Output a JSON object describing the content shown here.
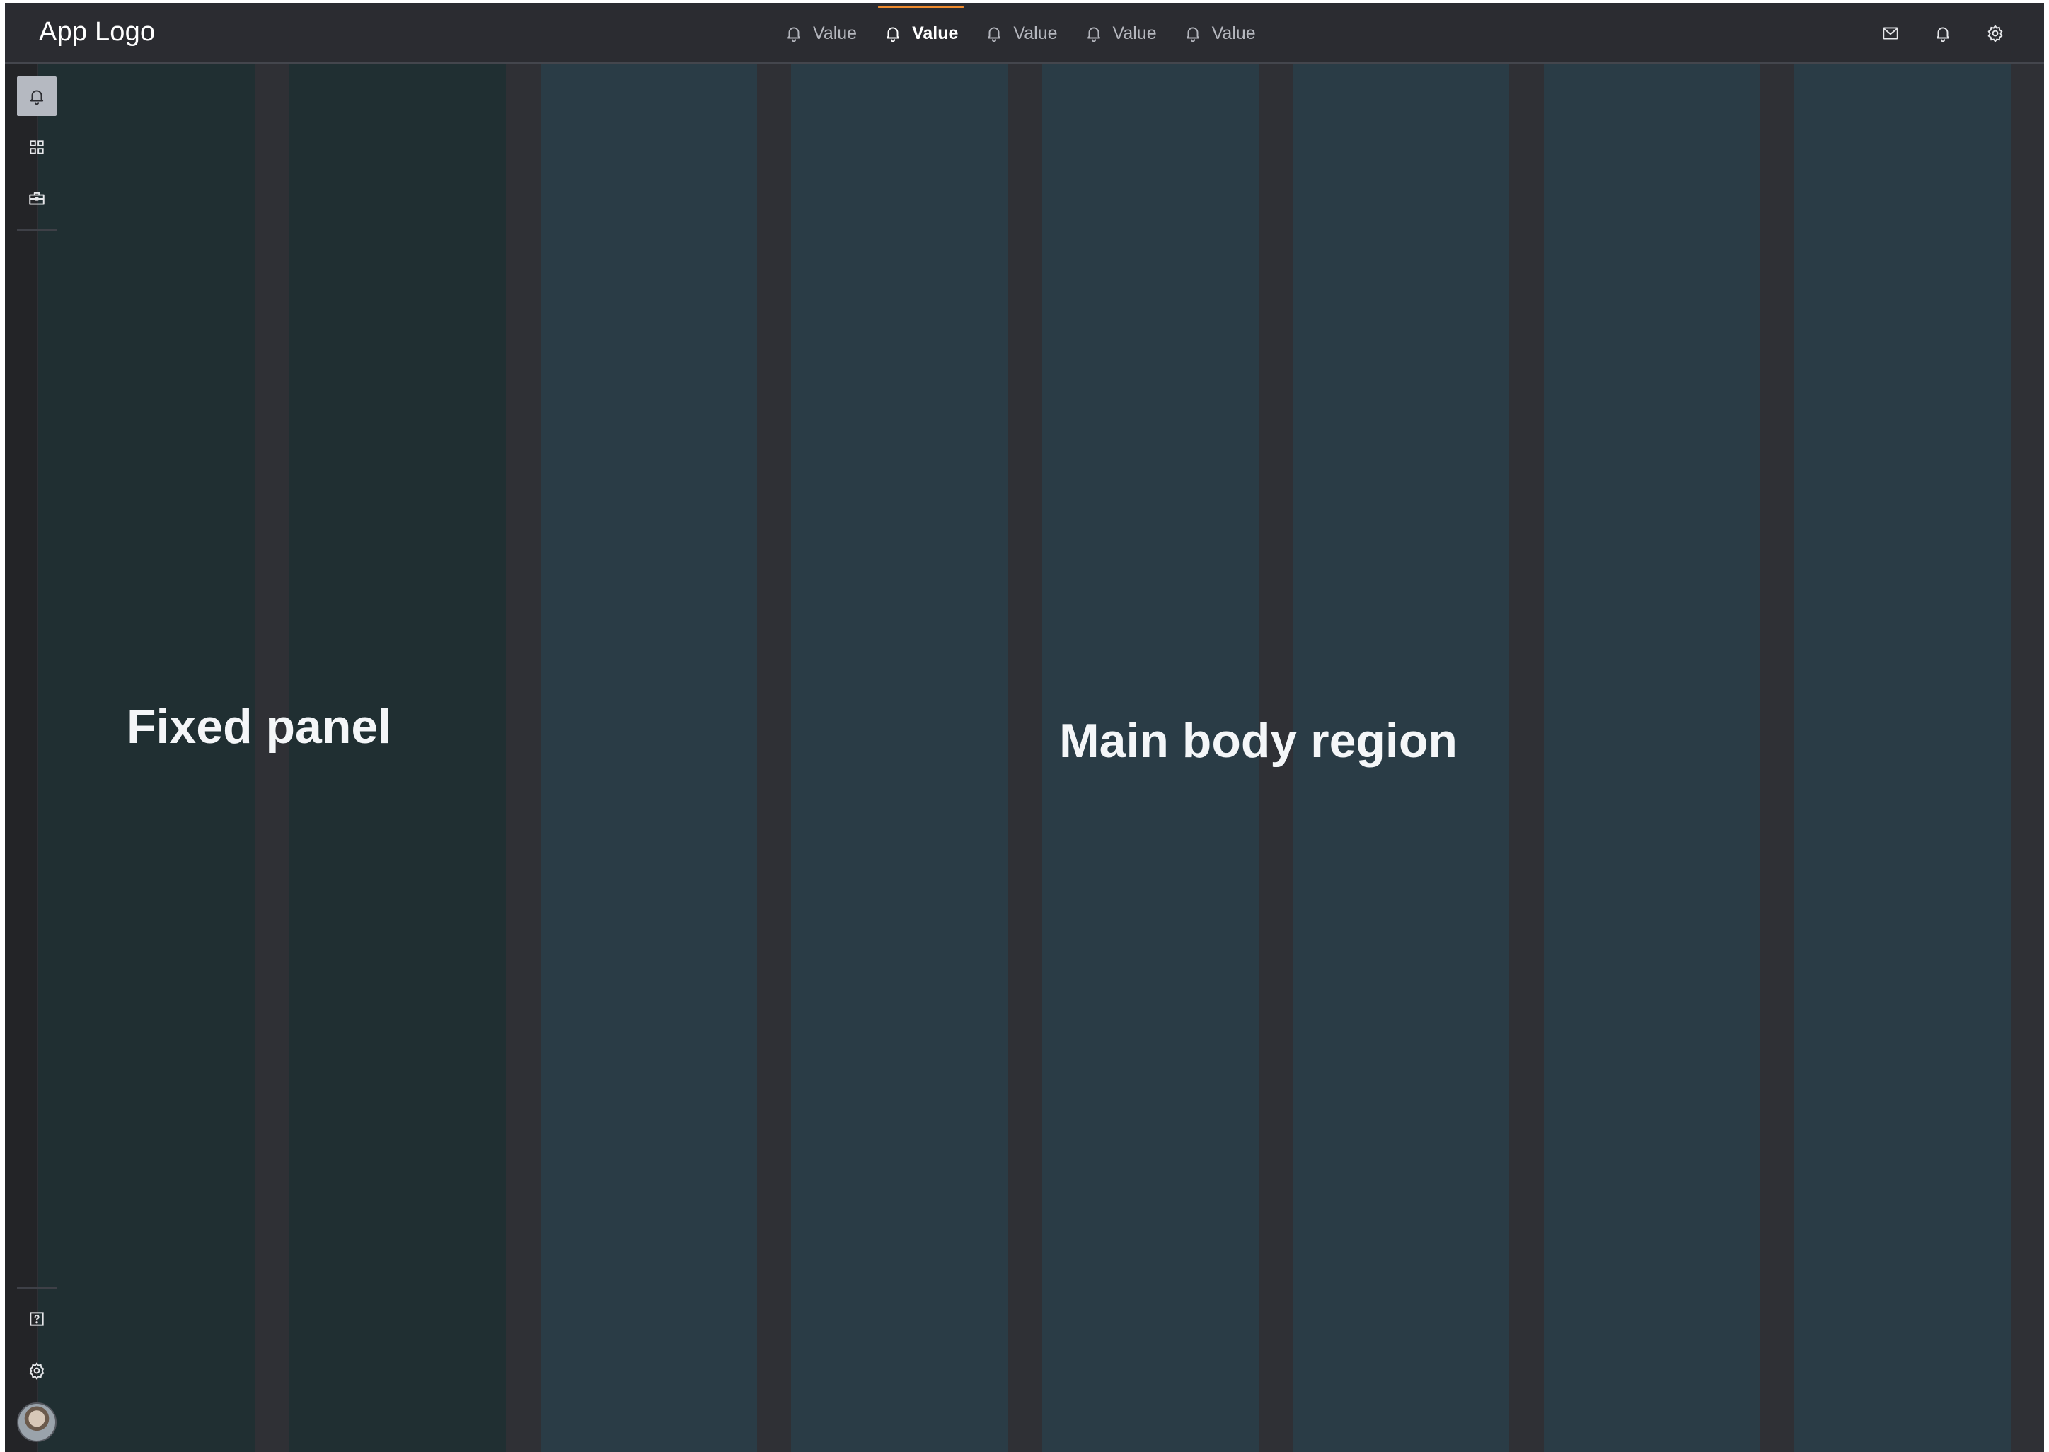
{
  "header": {
    "app_logo": "App Logo",
    "tabs": [
      {
        "label": "Value",
        "icon": "bell-icon",
        "active": false
      },
      {
        "label": "Value",
        "icon": "bell-icon",
        "active": true
      },
      {
        "label": "Value",
        "icon": "bell-icon",
        "active": false
      },
      {
        "label": "Value",
        "icon": "bell-icon",
        "active": false
      },
      {
        "label": "Value",
        "icon": "bell-icon",
        "active": false
      }
    ],
    "actions": [
      "mail-icon",
      "bell-icon",
      "gear-icon"
    ]
  },
  "rail": {
    "top_items": [
      {
        "icon": "bell-icon",
        "active": true
      },
      {
        "icon": "grid-icon",
        "active": false
      },
      {
        "icon": "briefcase-icon",
        "active": false
      }
    ],
    "bottom_items": [
      {
        "icon": "help-icon"
      },
      {
        "icon": "gear-icon"
      },
      {
        "icon": "avatar"
      }
    ]
  },
  "regions": {
    "fixed_panel": "Fixed panel",
    "main_body": "Main body region"
  },
  "colors": {
    "accent": "#f08a2c",
    "topbar": "#2b2c31",
    "fixed_column": "#202f32",
    "main_column": "#2a3c46",
    "gutter": "#2f3035"
  }
}
